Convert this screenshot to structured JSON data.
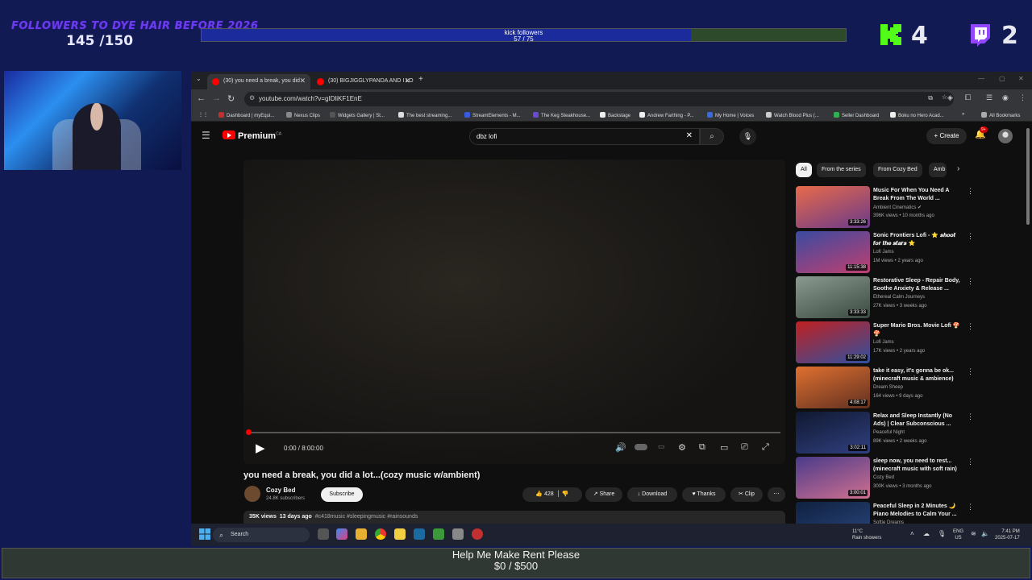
{
  "overlay": {
    "goal_title": "FOLLOWERS TO DYE HAIR BEFORE 2026",
    "goal_count": "145 /150",
    "kick_label": "kick followers",
    "kick_count": "57 / 75",
    "kick_progress": 0.76,
    "kick_counter": "4",
    "twitch_counter": "2",
    "rent_title": "Help Me Make Rent Please",
    "rent_amount": "$0 / $500",
    "colors": {
      "kick": "#53fc18",
      "twitch": "#9146ff",
      "goal_title": "#6b3cf0"
    }
  },
  "browser": {
    "tabs": [
      {
        "label": "(30) you need a break, you did"
      },
      {
        "label": "(30) BIGJIGGLYPANDA AND I LO"
      }
    ],
    "url": "youtube.com/watch?v=gIDliKF1EnE",
    "bookmarks": [
      "Dashboard | myEqui...",
      "Nexus Clips",
      "Widgets Gallery | St...",
      "The best streaming...",
      "StreamElements - M...",
      "The Keg Steakhouse...",
      "Backstage",
      "Andrew Farthing - P...",
      "My Home | Voices",
      "Watch Blood Plus (...",
      "Seller Dashboard",
      "Boku no Hero Acad...",
      "All Bookmarks"
    ]
  },
  "youtube": {
    "logo": "Premium",
    "region": "CA",
    "search_value": "dbz lofi",
    "create_label": "Create",
    "notif_count": "9+",
    "video_time": "0:00 / 8:00:00",
    "video_title": "you need a break, you did a lot...(cozy music w/ambient)",
    "channel_name": "Cozy Bed",
    "channel_subs": "24.8K subscribers",
    "subscribe_label": "Subscribe",
    "likes": "428",
    "share_label": "Share",
    "download_label": "Download",
    "thanks_label": "Thanks",
    "clip_label": "Clip",
    "views": "35K views",
    "posted": "13 days ago",
    "tags": "#c418music #sleepingmusic #rainsounds",
    "chips": [
      "All",
      "From the series",
      "From Cozy Bed",
      "Amb"
    ],
    "recommendations": [
      {
        "title": "Music For When You Need A Break From The World ...",
        "channel": "Ambient Cinematics ✔",
        "meta": "396K views • 10 months ago",
        "duration": "3:33:26",
        "colors": [
          "#e86a4a",
          "#6a3a8a"
        ]
      },
      {
        "title": "Sonic Frontiers Lofi - ⭐ 𝒔𝒉𝒐𝒐𝒕 𝒇𝒐𝒓 𝒕𝒉𝒆 𝒔𝒕𝒂𝒓𝒔 ⭐",
        "channel": "Lofi Jams",
        "meta": "1M views • 2 years ago",
        "duration": "11:15:38",
        "colors": [
          "#3a4aa0",
          "#c04070"
        ]
      },
      {
        "title": "Restorative Sleep - Repair Body, Soothe Anxiety & Release ...",
        "channel": "Ethereal Calm Journeys",
        "meta": "27K views • 3 weeks ago",
        "duration": "3:33:33",
        "colors": [
          "#8a9a90",
          "#3a4a40"
        ]
      },
      {
        "title": "Super Mario Bros. Movie Lofi 🍄🍄",
        "channel": "Lofi Jams",
        "meta": "17K views • 2 years ago",
        "duration": "11:29:02",
        "colors": [
          "#c02020",
          "#3050a0"
        ]
      },
      {
        "title": "take it easy, it's gonna be ok... (minecraft music & ambience)",
        "channel": "Dream Sheep",
        "meta": "164 views • 9 days ago",
        "duration": "4:08:17",
        "colors": [
          "#e07030",
          "#603020"
        ]
      },
      {
        "title": "Relax and Sleep Instantly (No Ads) | Clear Subconscious ...",
        "channel": "Peaceful Night",
        "meta": "89K views • 2 weeks ago",
        "duration": "3:02:11",
        "colors": [
          "#101830",
          "#304080"
        ]
      },
      {
        "title": "sleep now, you need to rest... (minecraft music with soft rain)",
        "channel": "Cozy Bed",
        "meta": "300K views • 3 months ago",
        "duration": "3:00:01",
        "colors": [
          "#4a3a8a",
          "#d07090"
        ]
      },
      {
        "title": "Peaceful Sleep in 2 Minutes 🌙 Piano Melodies to Calm Your ...",
        "channel": "Softie Dreams",
        "meta": "",
        "duration": "",
        "colors": [
          "#102040",
          "#2a4a80"
        ]
      }
    ]
  },
  "taskbar": {
    "search_placeholder": "Search",
    "temperature": "11°C",
    "weather": "Rain showers",
    "lang": "ENG",
    "region": "US",
    "time": "7:41 PM",
    "date": "2025-07-17"
  }
}
